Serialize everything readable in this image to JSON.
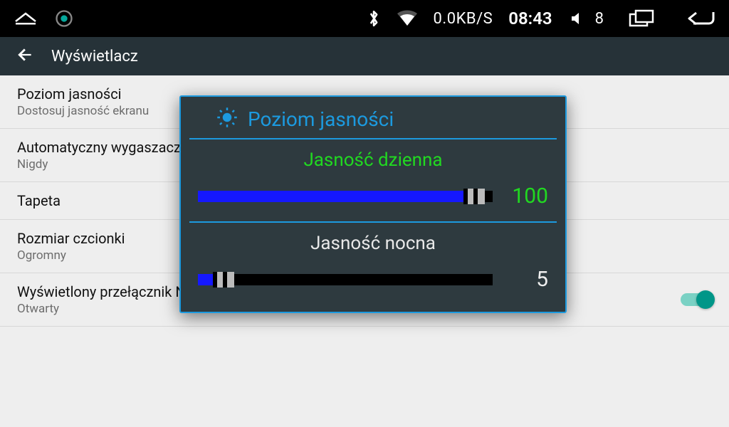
{
  "statusbar": {
    "data_rate": "0.0KB/S",
    "clock": "08:43",
    "volume": "8"
  },
  "actionbar": {
    "title": "Wyświetlacz"
  },
  "settings": [
    {
      "primary": "Poziom jasności",
      "secondary": "Dostosuj jasność ekranu"
    },
    {
      "primary": "Automatyczny wygaszacz ekranu",
      "secondary": "Nigdy"
    },
    {
      "primary": "Tapeta",
      "secondary": ""
    },
    {
      "primary": "Rozmiar czcionki",
      "secondary": "Ogromny"
    },
    {
      "primary": "Wyświetlony przełącznik NET",
      "secondary": "Otwarty"
    }
  ],
  "dialog": {
    "title": "Poziom jasności",
    "day_label": "Jasność dzienna",
    "day_value": "100",
    "day_percent": 100,
    "night_label": "Jasność nocna",
    "night_value": "5",
    "night_percent": 5
  }
}
